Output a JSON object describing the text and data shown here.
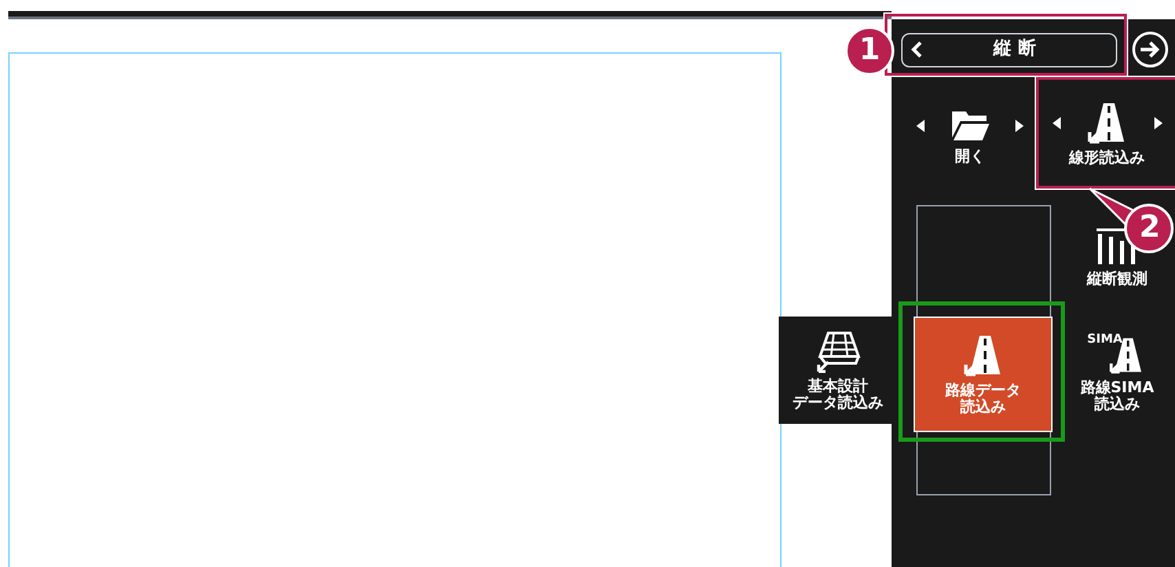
{
  "header": {
    "title": "縦 断"
  },
  "tiles": [
    {
      "kind": "folder",
      "lines": [
        "開く"
      ],
      "arrows": true,
      "selected": false
    },
    {
      "kind": "road",
      "lines": [
        "線形読込み"
      ],
      "arrows": true,
      "selected": false
    },
    {
      "kind": "pillars",
      "lines": [
        "縦断観測"
      ],
      "arrows": false,
      "selected": false
    },
    {
      "kind": "plan",
      "lines": [
        "基本設計",
        "データ読込み"
      ],
      "arrows": false,
      "selected": false
    },
    {
      "kind": "road",
      "lines": [
        "路線データ",
        "読込み"
      ],
      "arrows": false,
      "selected": true
    },
    {
      "kind": "sima",
      "badge": "SIMA",
      "lines": [
        "路線SIMA",
        "読込み"
      ],
      "arrows": false,
      "selected": false
    }
  ],
  "steps": [
    {
      "label": "1"
    },
    {
      "label": "2"
    }
  ]
}
